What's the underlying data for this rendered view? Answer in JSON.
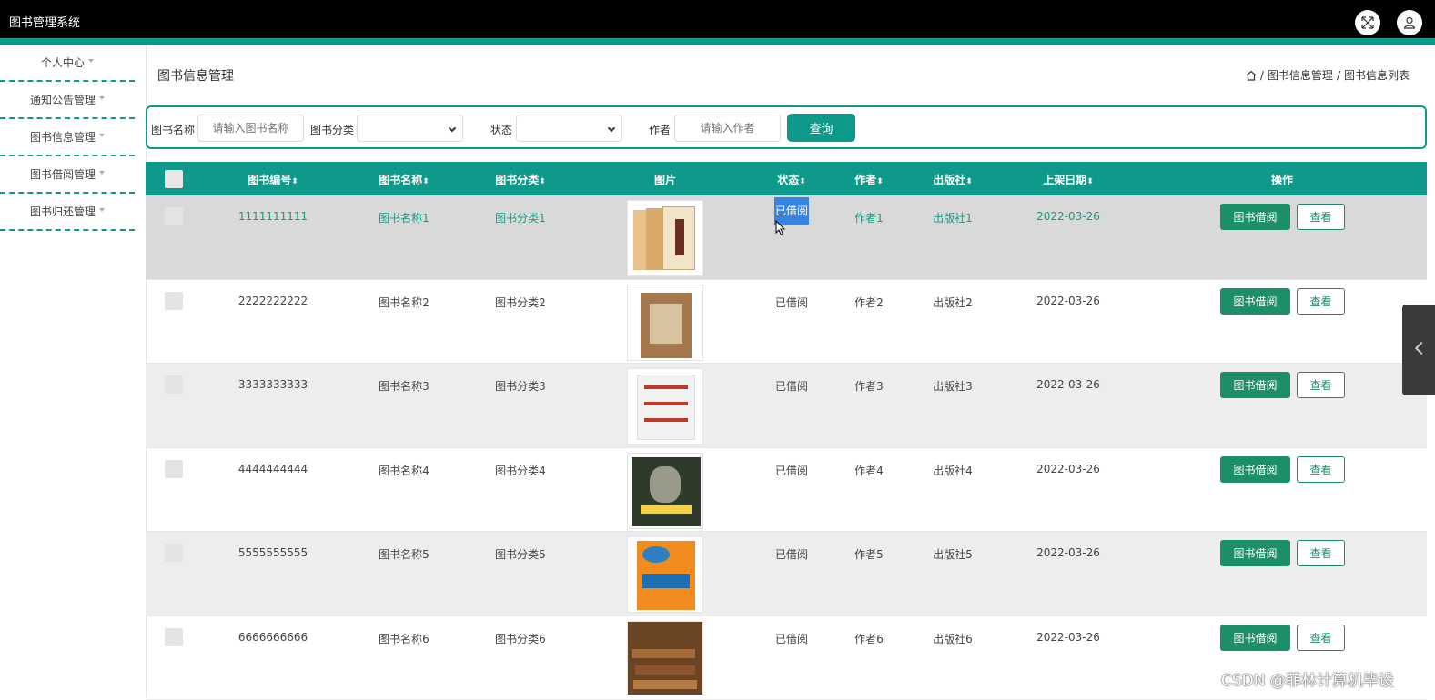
{
  "app": {
    "title": "图书管理系统",
    "accent": "#0e9a8a"
  },
  "header_icons": [
    "fullscreen-icon",
    "user-icon"
  ],
  "sidebar": {
    "items": [
      {
        "label": "个人中心"
      },
      {
        "label": "通知公告管理"
      },
      {
        "label": "图书信息管理"
      },
      {
        "label": "图书借阅管理"
      },
      {
        "label": "图书归还管理"
      }
    ]
  },
  "page": {
    "title": "图书信息管理"
  },
  "breadcrumb": {
    "items": [
      "图书信息管理",
      "图书信息列表"
    ],
    "sep": "/"
  },
  "search": {
    "name_label": "图书名称",
    "name_placeholder": "请输入图书名称",
    "category_label": "图书分类",
    "category_value": "",
    "status_label": "状态",
    "status_value": "",
    "author_label": "作者",
    "author_placeholder": "请输入作者",
    "query_label": "查询"
  },
  "table": {
    "headers": [
      "图书编号",
      "图书名称",
      "图书分类",
      "图片",
      "状态",
      "作者",
      "出版社",
      "上架日期",
      "操作"
    ],
    "sort_glyph": "⬍",
    "rows": [
      {
        "id": "1111111111",
        "name": "图书名称1",
        "category": "图书分类1",
        "status": "已借阅",
        "author": "作者1",
        "publisher": "出版社1",
        "date": "2022-03-26",
        "borrow": "图书借阅",
        "view": "查看"
      },
      {
        "id": "2222222222",
        "name": "图书名称2",
        "category": "图书分类2",
        "status": "已借阅",
        "author": "作者2",
        "publisher": "出版社2",
        "date": "2022-03-26",
        "borrow": "图书借阅",
        "view": "查看"
      },
      {
        "id": "3333333333",
        "name": "图书名称3",
        "category": "图书分类3",
        "status": "已借阅",
        "author": "作者3",
        "publisher": "出版社3",
        "date": "2022-03-26",
        "borrow": "图书借阅",
        "view": "查看"
      },
      {
        "id": "4444444444",
        "name": "图书名称4",
        "category": "图书分类4",
        "status": "已借阅",
        "author": "作者4",
        "publisher": "出版社4",
        "date": "2022-03-26",
        "borrow": "图书借阅",
        "view": "查看"
      },
      {
        "id": "5555555555",
        "name": "图书名称5",
        "category": "图书分类5",
        "status": "已借阅",
        "author": "作者5",
        "publisher": "出版社5",
        "date": "2022-03-26",
        "borrow": "图书借阅",
        "view": "查看"
      },
      {
        "id": "6666666666",
        "name": "图书名称6",
        "category": "图书分类6",
        "status": "已借阅",
        "author": "作者6",
        "publisher": "出版社6",
        "date": "2022-03-26",
        "borrow": "图书借阅",
        "view": "查看"
      }
    ]
  },
  "watermark": "CSDN @菲林计算机毕设"
}
